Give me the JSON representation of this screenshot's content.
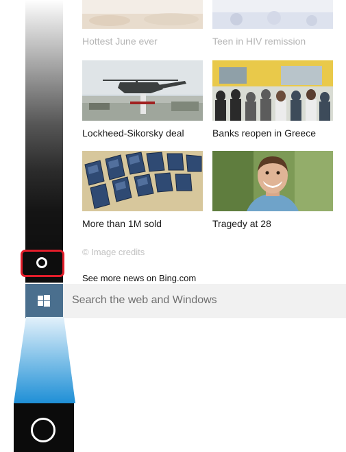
{
  "news": {
    "tiles": [
      {
        "caption": "Hottest June ever",
        "image": "heat-wave-photo"
      },
      {
        "caption": "Teen in HIV remission",
        "image": "hiv-news-photo"
      },
      {
        "caption": "Lockheed-Sikorsky deal",
        "image": "helicopter-photo"
      },
      {
        "caption": "Banks reopen in Greece",
        "image": "crowd-at-bank-photo"
      },
      {
        "caption": "More than 1M sold",
        "image": "solar-panels-photo"
      },
      {
        "caption": "Tragedy at 28",
        "image": "smiling-man-photo"
      }
    ],
    "image_credits": "© Image credits",
    "see_more": "See more news on Bing.com"
  },
  "taskbar": {
    "search_placeholder": "Search the web and Windows",
    "start_icon": "windows-logo-icon",
    "cortana_icon": "cortana-circle-icon"
  },
  "colors": {
    "highlight": "#e21d2a",
    "start_button": "#4a6f8e",
    "beam": "#2a9ad8"
  }
}
